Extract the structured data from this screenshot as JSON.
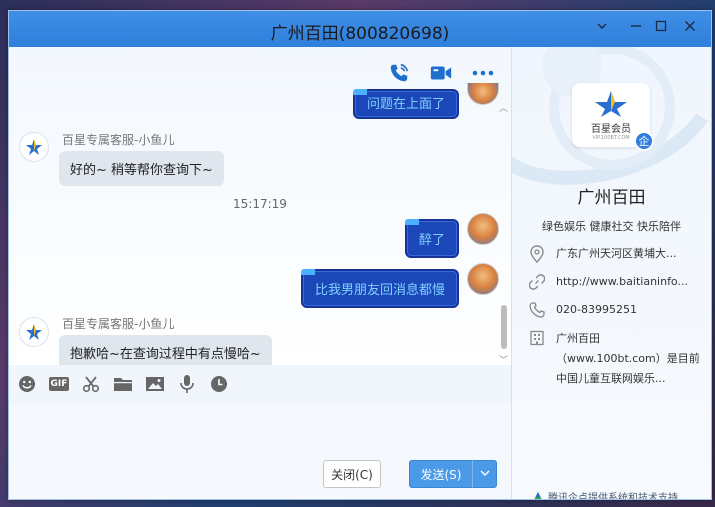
{
  "window": {
    "title": "广州百田(800820698)",
    "controls": [
      "chevron-down-icon",
      "minimize-icon",
      "maximize-icon",
      "close-icon"
    ]
  },
  "chat_toolbar": {
    "icons": [
      "phone-icon",
      "video-icon",
      "more-icon"
    ]
  },
  "messages": [
    {
      "side": "right",
      "text": "问题在上面了",
      "partial": true
    },
    {
      "side": "left",
      "sender": "百星专属客服-小鱼儿",
      "text": "好的~ 稍等帮你查询下~"
    },
    {
      "type": "time",
      "text": "15:17:19"
    },
    {
      "side": "right",
      "text": "醉了"
    },
    {
      "side": "right",
      "text": "比我男朋友回消息都慢"
    },
    {
      "side": "left",
      "sender": "百星专属客服-小鱼儿",
      "text": "抱歉哈~在查询过程中有点慢哈~"
    }
  ],
  "input_toolbar": {
    "gif_label": "GIF",
    "icons": [
      "emoji-icon",
      "gif-icon",
      "screenshot-scissors-icon",
      "folder-icon",
      "image-icon",
      "microphone-icon",
      "history-clock-icon"
    ]
  },
  "buttons": {
    "close_label": "关闭(C)",
    "send_label": "发送(S)"
  },
  "sidebar": {
    "logo_text": "百星会员",
    "logo_sub": "VIP.100BT.COM",
    "badge": "企",
    "name": "广州百田",
    "tags": "绿色娱乐  健康社交  快乐陪伴",
    "address": "广东广州天河区黄埔大...",
    "website": "http://www.baitianinfo...",
    "phone": "020-83995251",
    "description": "广州百田（www.100bt.com）是目前中国儿童互联网娱乐...",
    "footer": "腾讯企点提供系统和技术支持"
  },
  "colors": {
    "accent": "#2f7fdc",
    "bubble_self": "#1c47b8",
    "bubble_self_text": "#7fd0ff",
    "bubble_other": "#dfe6ee"
  }
}
